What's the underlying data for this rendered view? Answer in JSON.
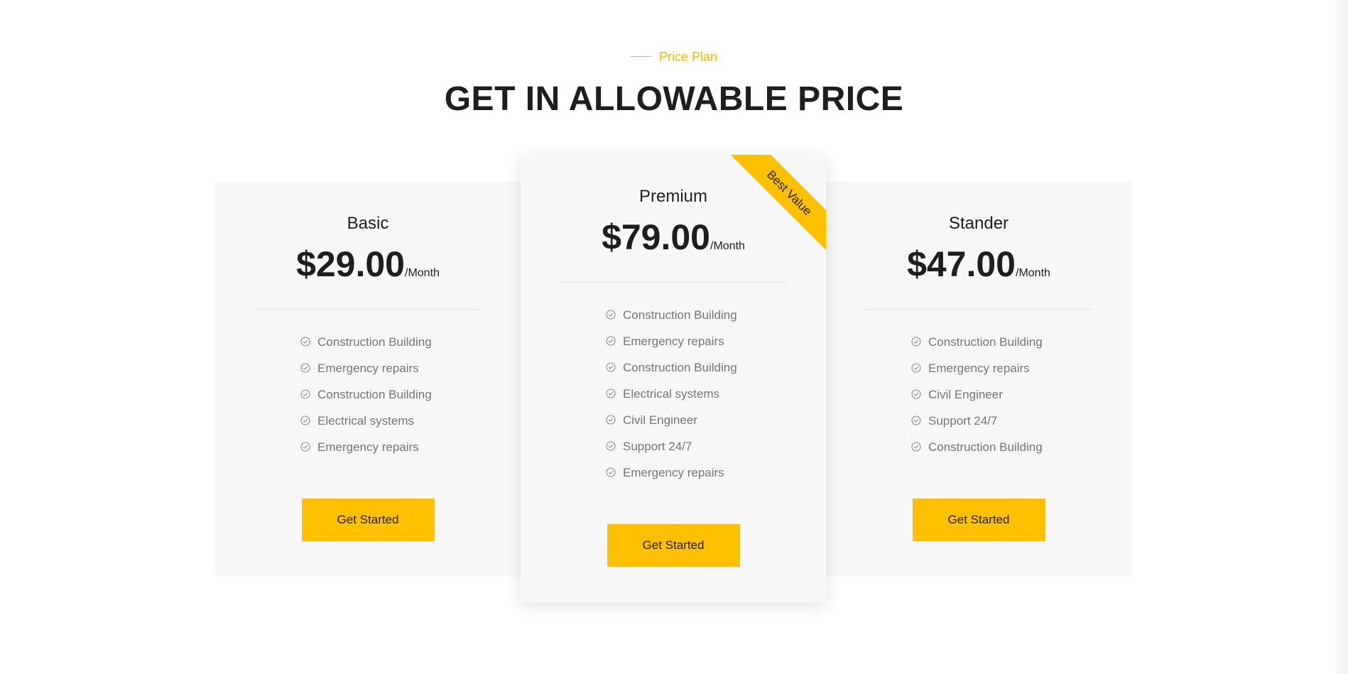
{
  "header": {
    "eyebrow": "Price Plan",
    "title": "GET IN ALLOWABLE PRICE"
  },
  "colors": {
    "accent": "#ffc000",
    "card_bg": "#f7f7f7",
    "heading": "#1e1e1e",
    "muted": "#757575"
  },
  "plans": [
    {
      "name": "Basic",
      "price": "$29.00",
      "period": "/Month",
      "features": [
        "Construction Building",
        "Emergency repairs",
        "Construction Building",
        "Electrical systems",
        "Emergency repairs"
      ],
      "button": "Get Started"
    },
    {
      "name": "Premium",
      "price": "$79.00",
      "period": "/Month",
      "badge": "Best Value",
      "features": [
        "Construction Building",
        "Emergency repairs",
        "Construction Building",
        "Electrical systems",
        "Civil Engineer",
        "Support 24/7",
        "Emergency repairs"
      ],
      "button": "Get Started"
    },
    {
      "name": "Stander",
      "price": "$47.00",
      "period": "/Month",
      "features": [
        "Construction Building",
        "Emergency repairs",
        "Civil Engineer",
        "Support 24/7",
        "Construction Building"
      ],
      "button": "Get Started"
    }
  ],
  "icons": {
    "feature_check": "check-circle-icon"
  }
}
